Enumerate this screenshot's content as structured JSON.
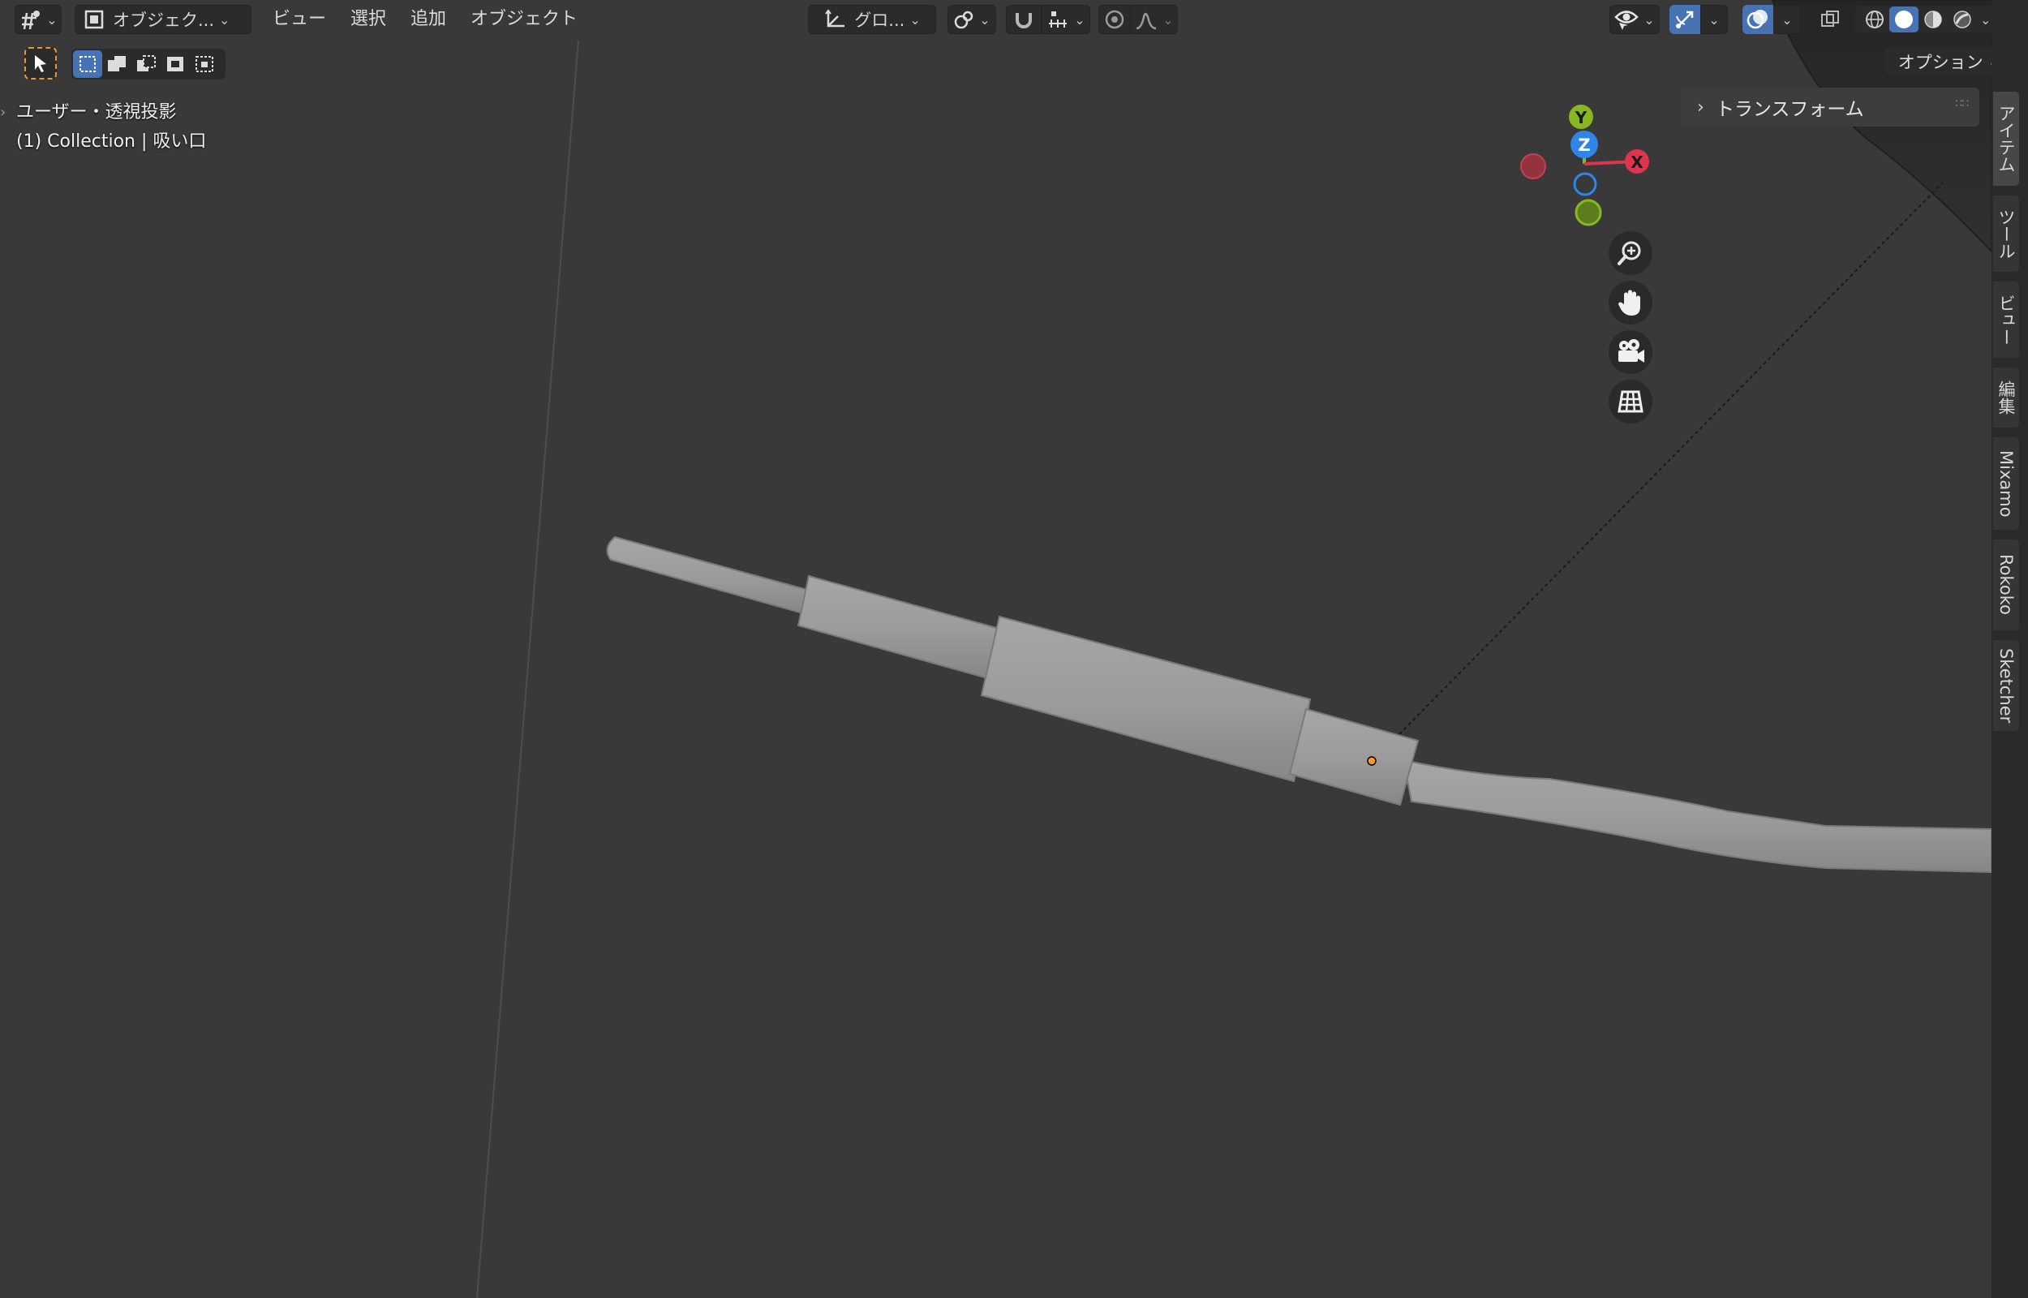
{
  "header": {
    "mode_label": "オブジェク...",
    "menus": [
      "ビュー",
      "選択",
      "追加",
      "オブジェクト"
    ],
    "transform_orientation": "グロ...",
    "options_label": "オプション"
  },
  "overlay": {
    "view_name": "ユーザー・透視投影",
    "collection_info": "(1) Collection | 吸い口"
  },
  "gizmo": {
    "axis_y": "Y",
    "axis_z": "Z",
    "axis_x": "X"
  },
  "npanel": {
    "transform_label": "トランスフォーム"
  },
  "sidebar": {
    "tabs": [
      {
        "label": "アイテム",
        "active": true
      },
      {
        "label": "ツール",
        "active": false
      },
      {
        "label": "ビュー",
        "active": false
      },
      {
        "label": "編集",
        "active": false
      },
      {
        "label": "Mixamo",
        "active": false
      },
      {
        "label": "Rokoko",
        "active": false
      },
      {
        "label": "Sketcher",
        "active": false
      }
    ]
  },
  "colors": {
    "background": "#393939",
    "accent": "#4772b3",
    "axis_x": "#e0334d",
    "axis_y": "#87b822",
    "axis_z": "#2f86e8",
    "selection_origin": "#ff9a1e"
  }
}
